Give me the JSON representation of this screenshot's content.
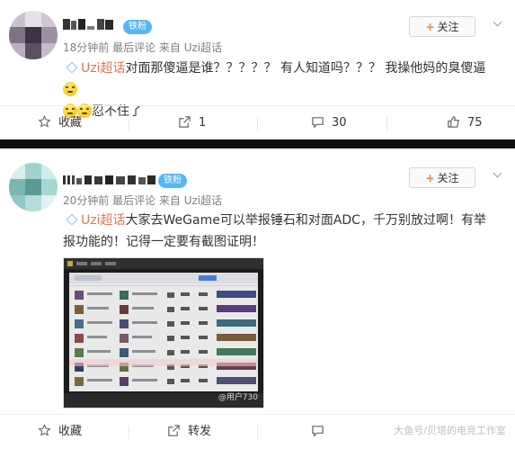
{
  "posts": [
    {
      "badge": "铁粉",
      "meta": "18分钟前 最后评论 来自 Uzi超话",
      "follow_label": "关注",
      "topic": "Uzi超话",
      "text": "对面那傻逼是谁？？？？？ 有人知道吗？？？ 我操他妈的臭傻逼",
      "text2": "忍不住了",
      "actions": {
        "favorite": "收藏",
        "forward": "1",
        "comment": "30",
        "like": "75"
      }
    },
    {
      "badge": "铁粉",
      "meta": "20分钟前 最后评论 来自 Uzi超话",
      "follow_label": "关注",
      "topic": "Uzi超话",
      "text": "大家去WeGame可以举报锤石和对面ADC，千万别放过啊！有举报功能的！记得一定要有截图证明！",
      "image_watermark": "@用户730",
      "actions": {
        "favorite": "收藏",
        "forward": "转发"
      }
    }
  ],
  "page_watermark": "大鱼号/贝塔的电竞工作室",
  "colors": {
    "topic": "#eb7350",
    "badge": "#58b5f5",
    "follow_plus": "#fa7d3c"
  }
}
